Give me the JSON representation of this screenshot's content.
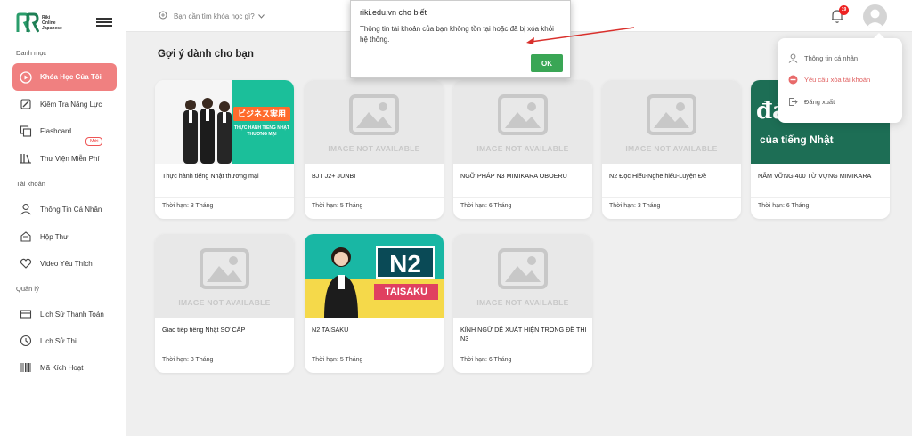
{
  "logo": {
    "text_lines": [
      "Riki",
      "Online",
      "Japanese"
    ]
  },
  "sidebar": {
    "sections": {
      "catalog": "Danh mục",
      "account": "Tài khoản",
      "manage": "Quản lý"
    },
    "items": [
      {
        "label": "Khóa Học Của Tôi",
        "icon": "play-circle-icon",
        "active": true
      },
      {
        "label": "Kiểm Tra Năng Lực",
        "icon": "pencil-icon"
      },
      {
        "label": "Flashcard",
        "icon": "cards-icon"
      },
      {
        "label": "Thư Viện Miễn Phí",
        "icon": "library-icon",
        "badge": "Mới"
      },
      {
        "label": "Thông Tin Cá Nhân",
        "icon": "user-icon"
      },
      {
        "label": "Hộp Thư",
        "icon": "mailbox-icon"
      },
      {
        "label": "Video Yêu Thích",
        "icon": "heart-icon"
      },
      {
        "label": "Lịch Sử Thanh Toán",
        "icon": "payment-icon"
      },
      {
        "label": "Lịch Sử Thi",
        "icon": "history-icon"
      },
      {
        "label": "Mã Kích Hoạt",
        "icon": "barcode-icon"
      }
    ]
  },
  "header": {
    "search_placeholder": "Bạn cần tìm khóa học gì?",
    "notification_count": "19"
  },
  "main": {
    "title": "Gợi ý dành cho bạn",
    "image_na_text": "IMAGE NOT AVAILABLE",
    "courses": [
      {
        "name": "Thực hành tiếng Nhật thương mại",
        "duration": "Thời hạn: 3 Tháng",
        "thumb": "business",
        "thumb_text": [
          "ビジネス実用",
          "THỰC HÀNH TIẾNG NHẬT",
          "THƯƠNG MẠI"
        ]
      },
      {
        "name": "BJT J2+ JUNBI",
        "duration": "Thời hạn: 5 Tháng",
        "thumb": "na"
      },
      {
        "name": "NGỮ PHÁP N3 MIMIKARA OBOERU",
        "duration": "Thời hạn: 6 Tháng",
        "thumb": "na"
      },
      {
        "name": "N2 Đọc Hiểu-Nghe hiểu-Luyện Đề",
        "duration": "Thời hạn: 3 Tháng",
        "thumb": "na"
      },
      {
        "name": "NẮM VỮNG 400 TỪ VỰNG MIMIKARA",
        "duration": "Thời hạn: 6 Tháng",
        "thumb": "vocab",
        "thumb_text": [
          "đánh cao",
          "của tiếng Nhật"
        ]
      },
      {
        "name": "Giao tiếp tiếng Nhật SƠ CẤP",
        "duration": "Thời hạn: 3 Tháng",
        "thumb": "na"
      },
      {
        "name": "N2 TAISAKU",
        "duration": "Thời hạn: 5 Tháng",
        "thumb": "n2",
        "thumb_text": [
          "N2",
          "TAISAKU"
        ]
      },
      {
        "name": "KÍNH NGỮ DỄ XUẤT HIỆN TRONG ĐỀ THI N3",
        "duration": "Thời hạn: 6 Tháng",
        "thumb": "na"
      }
    ]
  },
  "dialog": {
    "title": "riki.edu.vn cho biết",
    "message": "Thông tin tài khoản của bạn không tồn tại hoặc đã bị xóa khỏi hệ thống.",
    "ok_label": "OK"
  },
  "dropdown": {
    "items": [
      {
        "label": "Thông tin cá nhân",
        "icon": "user-icon"
      },
      {
        "label": "Yêu cầu xóa tài khoản",
        "icon": "minus-circle-icon",
        "danger": true
      },
      {
        "label": "Đăng xuất",
        "icon": "logout-icon"
      }
    ]
  },
  "colors": {
    "accent": "#f08080",
    "ok_button": "#3aa655",
    "badge": "#e22222"
  }
}
